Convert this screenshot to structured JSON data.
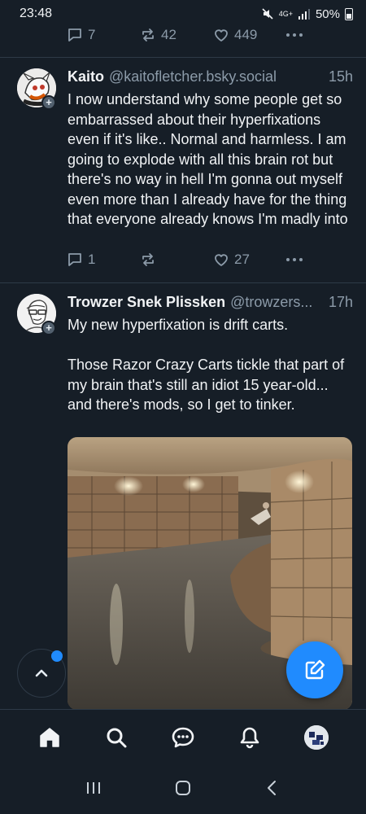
{
  "status_bar": {
    "time": "23:48",
    "network": "4G+",
    "battery": "50%"
  },
  "top_actions": {
    "replies": "7",
    "reposts": "42",
    "likes": "449"
  },
  "posts": [
    {
      "author": "Kaito",
      "handle": "@kaitofletcher.bsky.social",
      "time": "15h",
      "text": "I now understand why some people get so embarrassed about their hyperfixations even if it's like.. Normal and harmless. I am going to explode with all this brain rot but there's no way in hell I'm gonna out myself even more than I already have for the thing that everyone already knows I'm madly into",
      "replies": "1",
      "reposts": "",
      "likes": "27"
    },
    {
      "author": "Trowzer Snek Plissken",
      "handle": "@trowzers...",
      "time": "17h",
      "text": "My new hyperfixation is drift carts.\n\nThose Razor Crazy Carts tickle that part of my brain that's still an idiot 15 year-old... and there's mods, so I get to tinker."
    }
  ],
  "colors": {
    "background": "#161e27",
    "accent": "#208bfe",
    "muted": "#8c9ba9",
    "divider": "#2e3a47"
  },
  "icons": {
    "reply": "reply-icon",
    "repost": "repost-icon",
    "like": "heart-icon",
    "more": "more-dots-icon",
    "compose": "compose-icon",
    "scroll_top": "chevron-up-icon",
    "home": "home-icon",
    "search": "search-icon",
    "chat": "chat-icon",
    "notifications": "bell-icon",
    "recents": "recents-icon",
    "system_home": "system-home-icon",
    "back": "back-icon"
  }
}
